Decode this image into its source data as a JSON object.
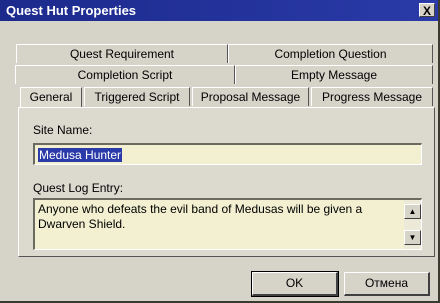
{
  "window": {
    "title": "Quest Hut Properties",
    "close_label": "X"
  },
  "tabs": {
    "row1": [
      "Quest Requirement",
      "Completion Question"
    ],
    "row2": [
      "Completion Script",
      "Empty Message"
    ],
    "row3": [
      "General",
      "Triggered Script",
      "Proposal Message",
      "Progress Message"
    ],
    "active": "General"
  },
  "general": {
    "site_name_label": "Site Name:",
    "site_name_value": "Medusa Hunter",
    "quest_log_label": "Quest Log Entry:",
    "quest_log_value": "Anyone who defeats the evil band of Medusas will be given a Dwarven Shield."
  },
  "buttons": {
    "ok_label": "OK",
    "cancel_label": "Отмена"
  }
}
